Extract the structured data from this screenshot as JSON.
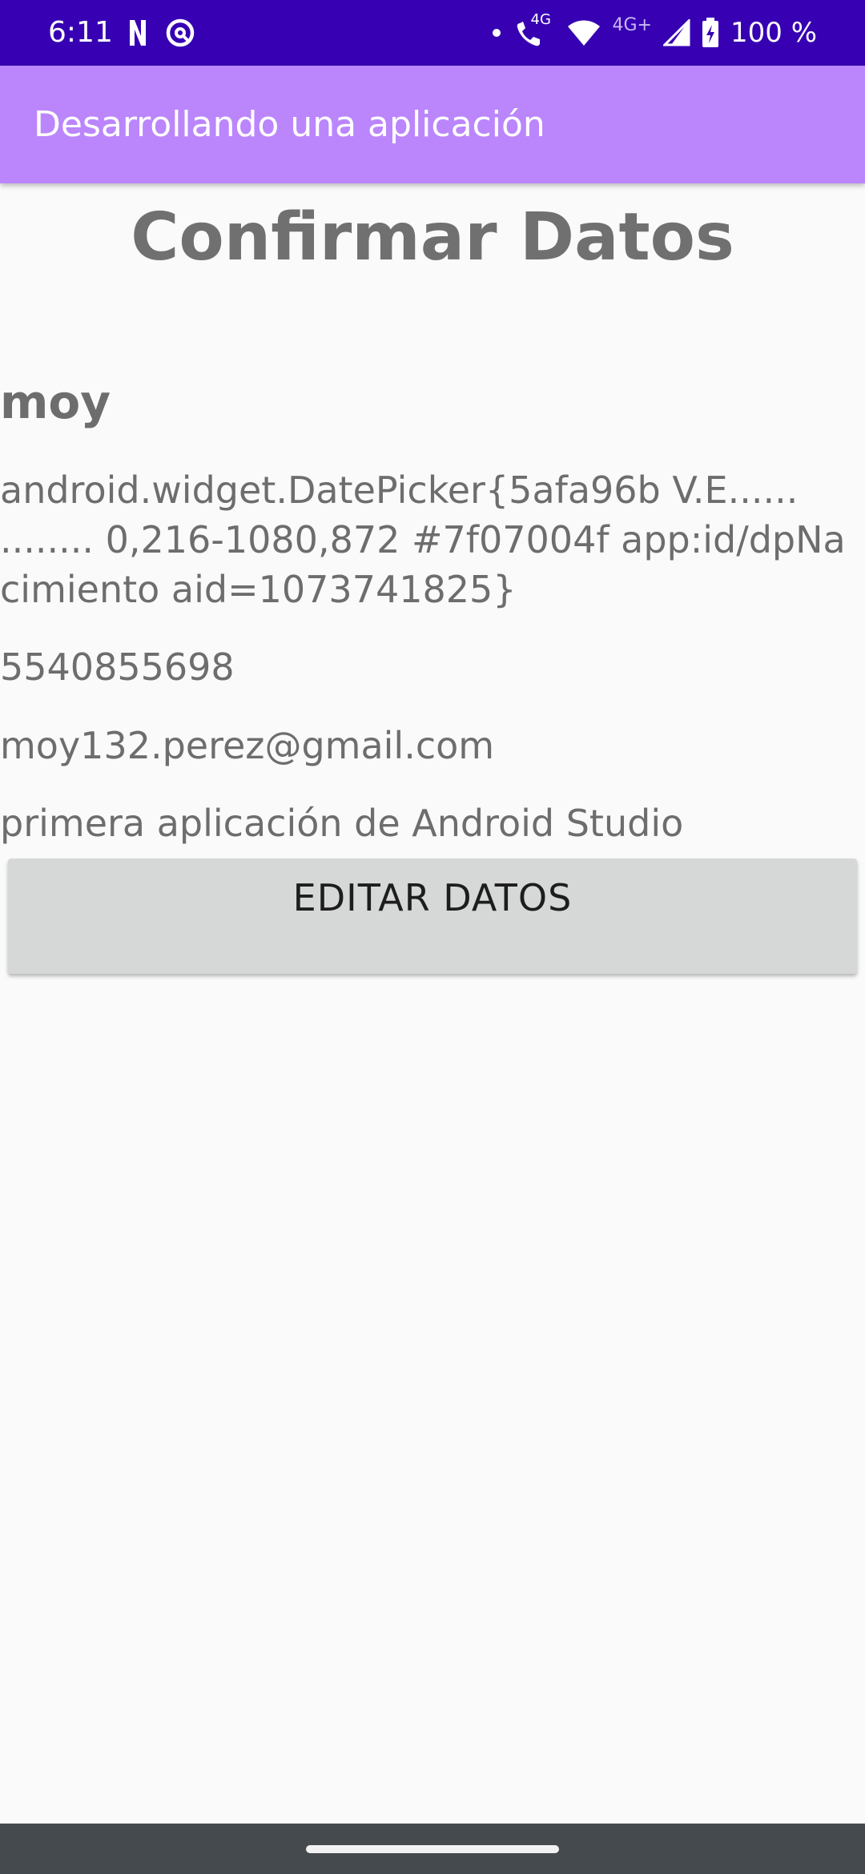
{
  "status_bar": {
    "time": "6:11",
    "network_small_label": "4G",
    "network_label": "4G+",
    "battery_text": "100 %",
    "background_color": "#3700b3",
    "icons": [
      "netflix-icon",
      "vpn-icon",
      "notification-dot-icon",
      "wifi-call-icon",
      "wifi-icon",
      "signal-icon",
      "battery-charging-icon"
    ]
  },
  "app_bar": {
    "title": "Desarrollando una aplicación",
    "background_color": "#bb86fc"
  },
  "main": {
    "page_title": "Confirmar Datos",
    "name": "moy",
    "birth_date": "android.widget.DatePicker{5afa96b V.E...... ........ 0,216-1080,872 #7f07004f app:id/dpNacimiento aid=1073741825}",
    "phone": "5540855698",
    "email": "moy132.perez@gmail.com",
    "description": "primera aplicación de Android Studio",
    "edit_button_label": "EDITAR DATOS"
  },
  "nav_bar": {
    "background_color": "#454a4e"
  }
}
